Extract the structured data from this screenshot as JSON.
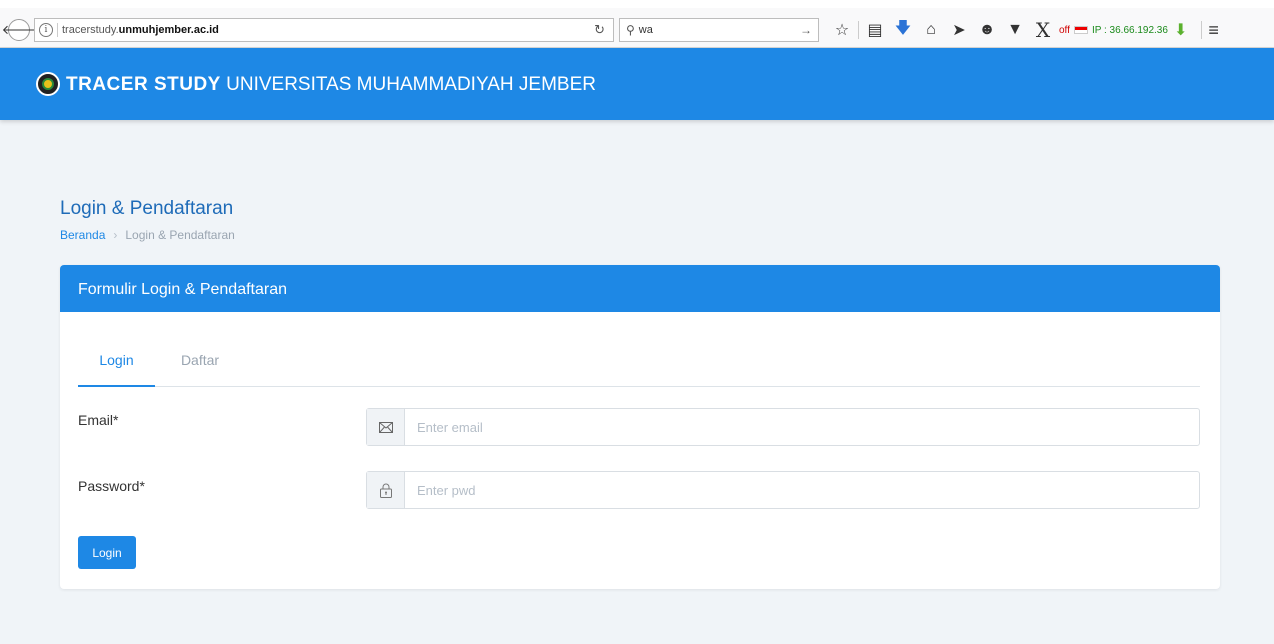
{
  "browser": {
    "url_prefix": "tracerstudy.",
    "url_domain": "unmuhjember.ac.id",
    "search_value": "wa",
    "status_off": "off",
    "ip_text": "IP : 36.66.192.36"
  },
  "header": {
    "title_bold": "TRACER STUDY",
    "title_rest": "UNIVERSITAS MUHAMMADIYAH JEMBER"
  },
  "page": {
    "title": "Login & Pendaftaran",
    "breadcrumb_home": "Beranda",
    "breadcrumb_current": "Login & Pendaftaran"
  },
  "card": {
    "title": "Formulir Login & Pendaftaran",
    "tabs": [
      {
        "label": "Login"
      },
      {
        "label": "Daftar"
      }
    ],
    "email_label": "Email*",
    "email_placeholder": "Enter email",
    "password_label": "Password*",
    "password_placeholder": "Enter pwd",
    "login_button": "Login"
  },
  "colors": {
    "primary": "#1e88e5",
    "background": "#f0f4f8"
  },
  "icons": [
    "back-arrow-icon",
    "info-icon",
    "reload-icon",
    "search-icon",
    "bookmark-star-icon",
    "clipboard-icon",
    "download-icon",
    "home-icon",
    "send-icon",
    "chat-icon",
    "pocket-icon",
    "x-icon",
    "flag-icon",
    "green-arrow-icon",
    "menu-icon",
    "email-icon",
    "lock-icon"
  ]
}
